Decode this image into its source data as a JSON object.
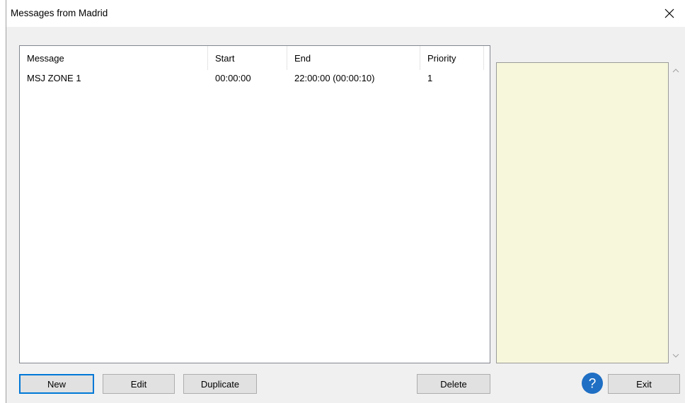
{
  "window": {
    "title": "Messages from Madrid",
    "close_glyph": "×"
  },
  "list": {
    "columns": [
      {
        "label": "Message"
      },
      {
        "label": "Start"
      },
      {
        "label": "End"
      },
      {
        "label": "Priority"
      }
    ],
    "rows": [
      {
        "message": "MSJ ZONE 1",
        "start": "00:00:00",
        "end": "22:00:00 (00:00:10)",
        "priority": "1"
      }
    ]
  },
  "preview": {
    "text": "",
    "background": "#f7f7dc"
  },
  "buttons": {
    "new": "New",
    "edit": "Edit",
    "duplicate": "Duplicate",
    "delete": "Delete",
    "exit": "Exit"
  },
  "icons": {
    "help": "help-icon",
    "close": "close-icon"
  },
  "colors": {
    "accent": "#0078d7",
    "help": "#1f6fc4"
  }
}
